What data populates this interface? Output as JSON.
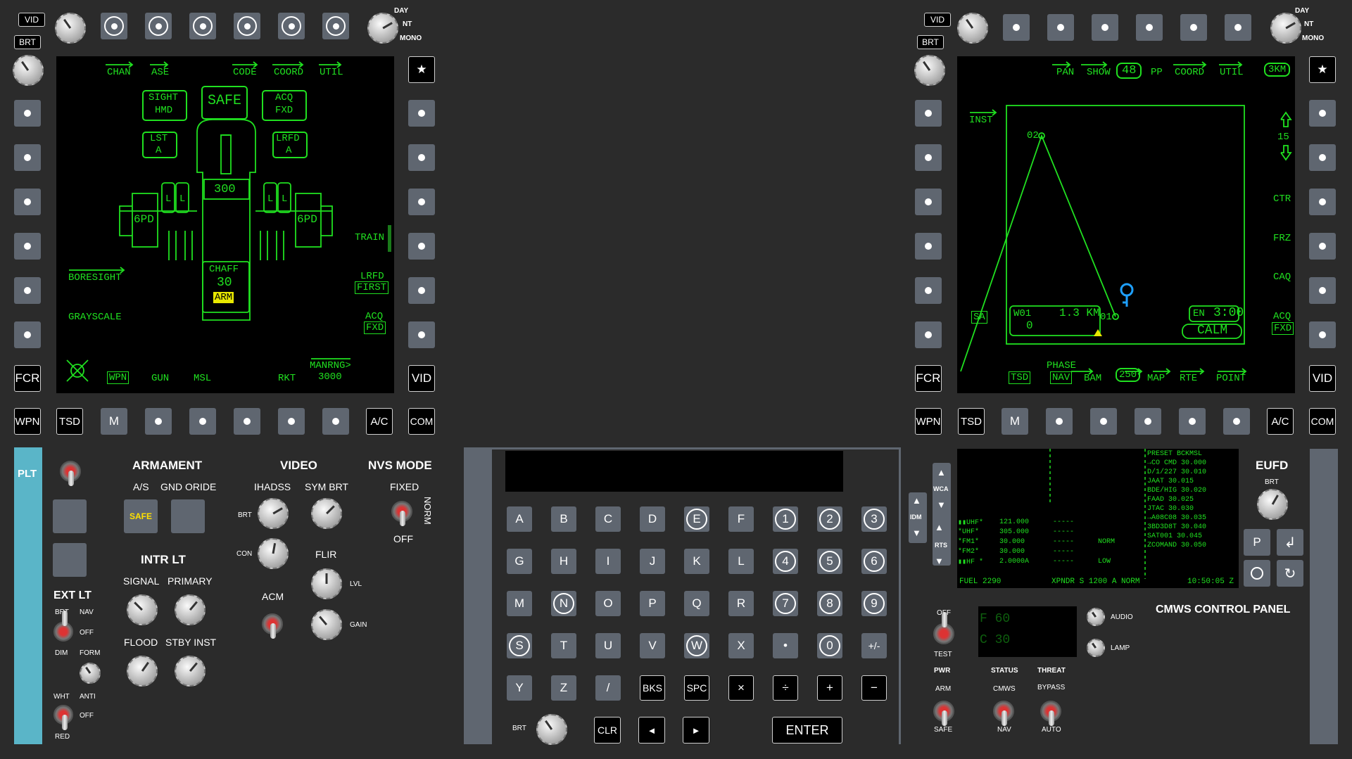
{
  "left_mfd": {
    "vid": "VID",
    "brt": "BRT",
    "day": "DAY",
    "nt": "NT",
    "mono": "MONO",
    "star": "★",
    "fcr": "FCR",
    "vid_right": "VID",
    "wpn": "WPN",
    "tsd": "TSD",
    "m": "M",
    "ac": "A/C",
    "com": "COM",
    "screen": {
      "chan": "CHAN",
      "ase": "ASE",
      "code": "CODE",
      "coord": "COORD",
      "util": "UTIL",
      "sight": "SIGHT",
      "hmd": "HMD",
      "safe": "SAFE",
      "acq": "ACQ",
      "fxd": "FXD",
      "lst": "LST",
      "lst_a": "A",
      "lrfd": "LRFD",
      "lrfd_a": "A",
      "ammo": "300",
      "pod_l": "6PD",
      "pod_r": "6PD",
      "l": "L",
      "chaff": "CHAFF",
      "chaff_count": "30",
      "arm": "ARM",
      "boresight": "BORESIGHT",
      "grayscale": "GRAYSCALE",
      "train": "TRAIN",
      "lrfd_first_1": "LRFD",
      "lrfd_first_2": "FIRST",
      "acq2": "ACQ",
      "fxd2": "FXD",
      "wpn": "WPN",
      "gun": "GUN",
      "msl": "MSL",
      "rkt": "RKT",
      "manrng": "MANRNG>",
      "manrng_val": "3000"
    }
  },
  "right_mfd": {
    "vid": "VID",
    "brt": "BRT",
    "day": "DAY",
    "nt": "NT",
    "mono": "MONO",
    "star": "★",
    "fcr": "FCR",
    "vid_right": "VID",
    "wpn": "WPN",
    "tsd": "TSD",
    "m": "M",
    "ac": "A/C",
    "com": "COM",
    "screen": {
      "pan": "PAN",
      "show": "SHOW",
      "scale": "48",
      "pp": "PP",
      "coord": "COORD",
      "util": "UTIL",
      "range": "3KM",
      "inst": "INST",
      "wp02": "02",
      "wp01": "01",
      "zoom": "15",
      "ctr": "CTR",
      "frz": "FRZ",
      "caq": "CAQ",
      "acq": "ACQ",
      "fxd": "FXD",
      "sa": "SA",
      "w01": "W01",
      "dist": "1.3 KM",
      "zero": "0",
      "en": "EN",
      "en_time": "3:00",
      "calm": "CALM",
      "tsd": "TSD",
      "phase": "PHASE",
      "nav": "NAV",
      "bam": "BAM",
      "val250": "250",
      "map": "MAP",
      "rte": "RTE",
      "point": "POINT"
    }
  },
  "left_panel": {
    "plt": "PLT",
    "armament": "ARMAMENT",
    "as": "A/S",
    "gnd_oride": "GND ORIDE",
    "safe": "SAFE",
    "video": "VIDEO",
    "ihadss": "IHADSS",
    "sym_brt": "SYM BRT",
    "brt": "BRT",
    "con": "CON",
    "flir": "FLIR",
    "lvl": "LVL",
    "gain": "GAIN",
    "acm": "ACM",
    "nvs_mode": "NVS MODE",
    "fixed": "FIXED",
    "norm": "NORM",
    "off": "OFF",
    "intr_lt": "INTR LT",
    "signal": "SIGNAL",
    "primary": "PRIMARY",
    "flood": "FLOOD",
    "stby_inst": "STBY INST",
    "ext_lt": "EXT LT",
    "ext_brt": "BRT",
    "nav": "NAV",
    "ext_off": "OFF",
    "dim": "DIM",
    "form": "FORM",
    "wht": "WHT",
    "anti": "ANTI",
    "off2": "OFF",
    "red": "RED"
  },
  "keyboard": {
    "rows": [
      [
        "A",
        "B",
        "C",
        "D",
        "E",
        "F",
        "1",
        "2",
        "3"
      ],
      [
        "G",
        "H",
        "I",
        "J",
        "K",
        "L",
        "4",
        "5",
        "6"
      ],
      [
        "M",
        "N",
        "O",
        "P",
        "Q",
        "R",
        "7",
        "8",
        "9"
      ],
      [
        "S",
        "T",
        "U",
        "V",
        "W",
        "X",
        "•",
        "0",
        "+/-"
      ],
      [
        "Y",
        "Z",
        "/",
        "BKS",
        "SPC",
        "×",
        "÷",
        "+",
        "−"
      ]
    ],
    "brt": "BRT",
    "clr": "CLR",
    "left": "◄",
    "right": "►",
    "enter": "ENTER"
  },
  "eufd": {
    "wca": "WCA",
    "idm": "IDM",
    "rts": "RTS",
    "title": "EUFD",
    "brt": "BRT",
    "p": "P",
    "enter_icon": "↲",
    "lines_right": [
      "PRESET BCKMSL",
      "→CO CMD   30.000",
      "D/1/227   30.010",
      "JAAT      30.015",
      "BDE/HIG   30.020",
      "FAAD      30.025",
      "JTAC      30.030",
      "→A08C08   30.035",
      "3BD3D8T   30.040",
      "SAT001    30.045",
      "ZCOMAND   30.050"
    ],
    "radio": [
      {
        "ch": "▮▮UHF*",
        "freq": "121.000",
        "dash": "-----",
        "mode": ""
      },
      {
        "ch": " *UHF*",
        "freq": "305.000",
        "dash": "-----",
        "mode": ""
      },
      {
        "ch": "*FM1*",
        "freq": "30.000",
        "dash": "-----",
        "mode": "NORM"
      },
      {
        "ch": "*FM2*",
        "freq": "30.000",
        "dash": "-----",
        "mode": ""
      },
      {
        "ch": "▮▮HF *",
        "freq": "2.0000A",
        "dash": "-----",
        "mode": "LOW"
      }
    ],
    "fuel": "FUEL 2290",
    "xpndr": "XPNDR S 1200 A NORM",
    "time": "10:50:05 Z"
  },
  "cmws": {
    "title": "CMWS CONTROL PANEL",
    "off": "OFF",
    "test": "TEST",
    "pwr": "PWR",
    "f_line": "F 60",
    "c_line": "C 30",
    "audio": "AUDIO",
    "lamp": "LAMP",
    "status": "STATUS",
    "threat": "THREAT",
    "arm": "ARM",
    "cmws": "CMWS",
    "bypass": "BYPASS",
    "safe": "SAFE",
    "nav": "NAV",
    "auto": "AUTO"
  }
}
